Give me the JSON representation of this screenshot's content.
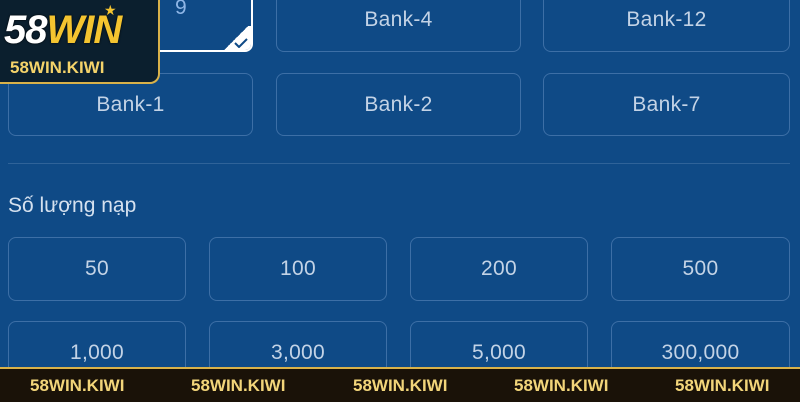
{
  "banks": {
    "selected_fragment": "9",
    "row1": [
      "Bank-4",
      "Bank-12"
    ],
    "row2": [
      "Bank-1",
      "Bank-2",
      "Bank-7"
    ]
  },
  "amount_section": {
    "label": "Số lượng nạp",
    "row1": [
      "50",
      "100",
      "200",
      "500"
    ],
    "row2": [
      "1,000",
      "3,000",
      "5,000",
      "300,000"
    ]
  },
  "logo": {
    "prefix": "58",
    "accent": "WIN",
    "subtitle": "58WIN.KIWI"
  },
  "watermark_strip": [
    "58WIN.KIWI",
    "58WIN.KIWI",
    "58WIN.KIWI",
    "58WIN.KIWI",
    "58WIN.KIWI"
  ],
  "colors": {
    "background": "#0f4a86",
    "border": "#3d6fa6",
    "logo_gold": "#f4c430"
  }
}
